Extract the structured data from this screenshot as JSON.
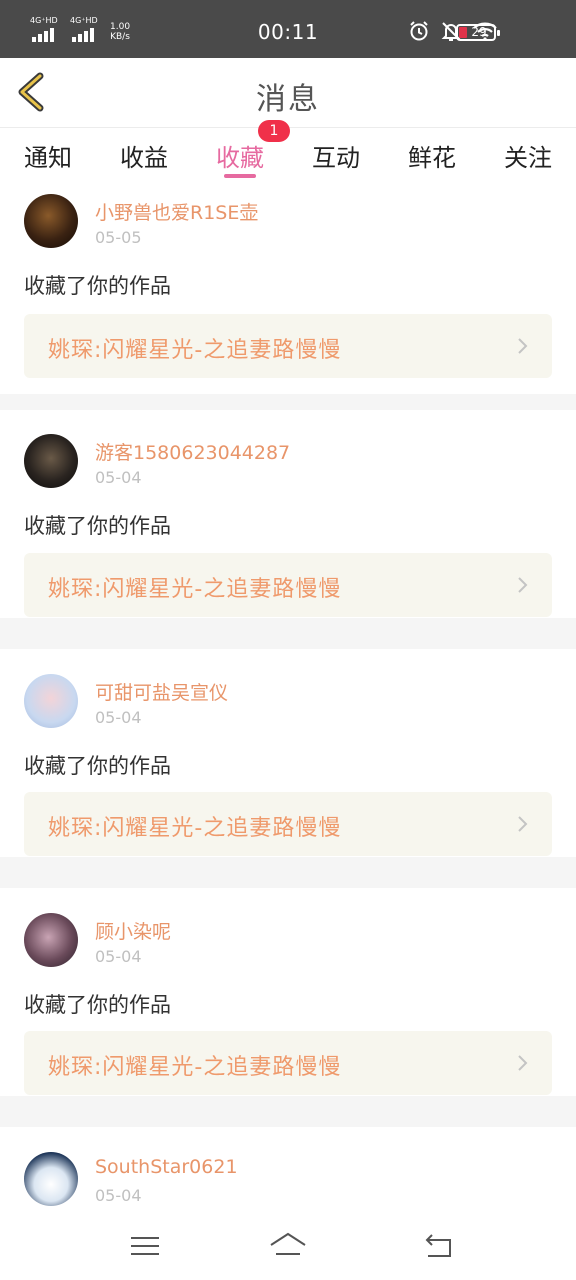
{
  "status_bar": {
    "network1": "4G⁺HD",
    "network2": "4G⁺HD",
    "speed_value": "1.00",
    "speed_unit": "KB/s",
    "time": "00:11",
    "battery": "29"
  },
  "header": {
    "title": "消息",
    "back_icon": "chevron-left-icon"
  },
  "tabs": [
    {
      "label": "通知"
    },
    {
      "label": "收益"
    },
    {
      "label": "收藏",
      "active": true,
      "badge": "1"
    },
    {
      "label": "互动"
    },
    {
      "label": "鲜花"
    },
    {
      "label": "关注"
    }
  ],
  "messages": [
    {
      "username": "小野兽也爱R1SE壶",
      "date": "05-05",
      "action": "收藏了你的作品",
      "work_title": "姚琛:闪耀星光-之追妻路慢慢"
    },
    {
      "username": "游客1580623044287",
      "date": "05-04",
      "action": "收藏了你的作品",
      "work_title": "姚琛:闪耀星光-之追妻路慢慢"
    },
    {
      "username": "可甜可盐吴宣仪",
      "date": "05-04",
      "action": "收藏了你的作品",
      "work_title": "姚琛:闪耀星光-之追妻路慢慢"
    },
    {
      "username": "顾小染呢",
      "date": "05-04",
      "action": "收藏了你的作品",
      "work_title": "姚琛:闪耀星光-之追妻路慢慢"
    },
    {
      "username": "SouthStar0621",
      "date": "05-04",
      "action": "",
      "work_title": ""
    }
  ],
  "colors": {
    "accent": "#e66aa0",
    "username": "#e8956a",
    "work_title": "#ef9a6c",
    "badge": "#f0304a",
    "status_bar": "#4a4a4a"
  }
}
